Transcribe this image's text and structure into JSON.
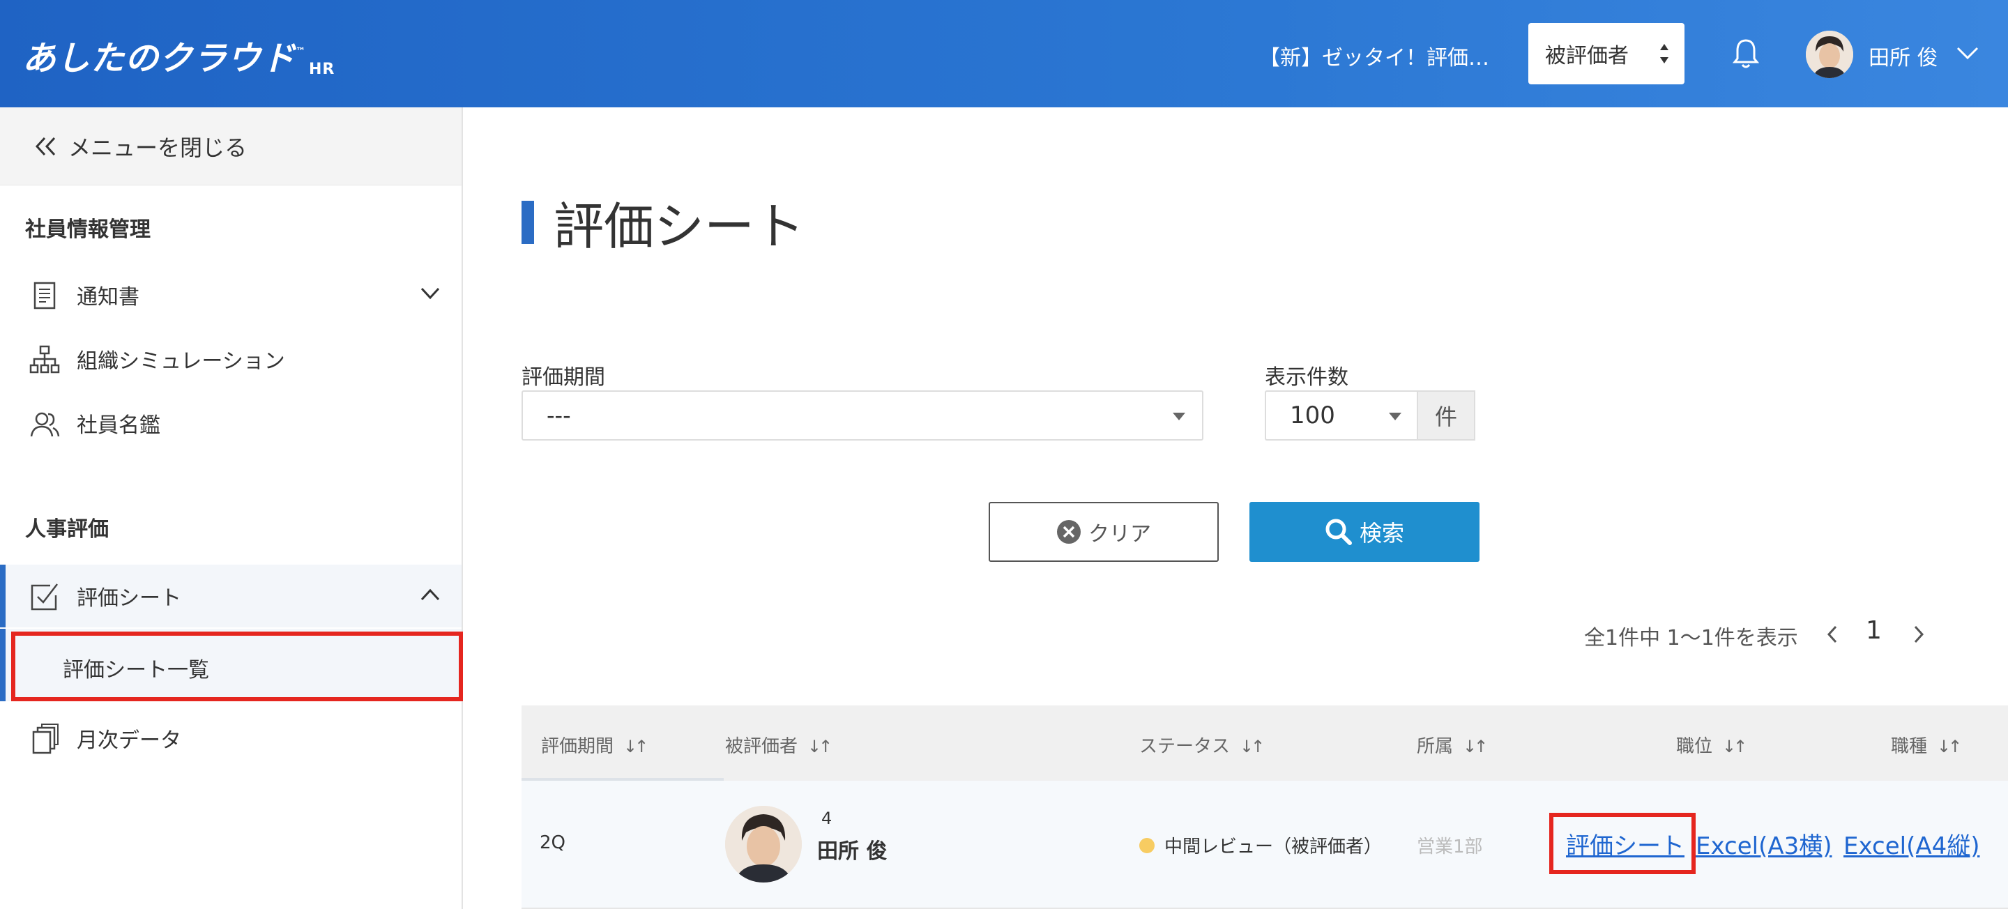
{
  "header": {
    "logo_text": "あしたのクラウド",
    "logo_suffix": "HR",
    "logo_tm": "™",
    "title": "【新】ゼッタイ！評価…",
    "role_select": "被評価者",
    "user_name": "田所 俊"
  },
  "sidebar": {
    "close_menu": "メニューを閉じる",
    "section_employee": "社員情報管理",
    "items": {
      "notice": "通知書",
      "org_sim": "組織シミュレーション",
      "directory": "社員名鑑"
    },
    "section_hr": "人事評価",
    "eval_sheet": "評価シート",
    "eval_sheet_list": "評価シート一覧",
    "monthly": "月次データ"
  },
  "main": {
    "page_title": "評価シート",
    "period_label": "評価期間",
    "period_value": "---",
    "count_label": "表示件数",
    "count_value": "100",
    "count_unit": "件",
    "clear_button": "クリア",
    "search_button": "検索",
    "pager_info": "全1件中 1〜1件を表示",
    "page_number": "1",
    "columns": [
      "評価期間",
      "被評価者",
      "ステータス",
      "所属",
      "職位",
      "職種"
    ],
    "sort_glyph": "↓↑",
    "row": {
      "period": "2Q",
      "employee_num": "4",
      "employee_name": "田所 俊",
      "status": "中間レビュー（被評価者）",
      "department": "営業1部",
      "link_sheet": "評価シート",
      "link_a3": "Excel(A3横)",
      "link_a4": "Excel(A4縦)"
    }
  },
  "colors": {
    "header_blue": "#2b77d3",
    "accent_blue": "#2b6cc4",
    "search_button": "#1f8fcf",
    "highlight_red": "#e5261f",
    "status_dot": "#f7cc62",
    "link": "#1f66d0"
  }
}
